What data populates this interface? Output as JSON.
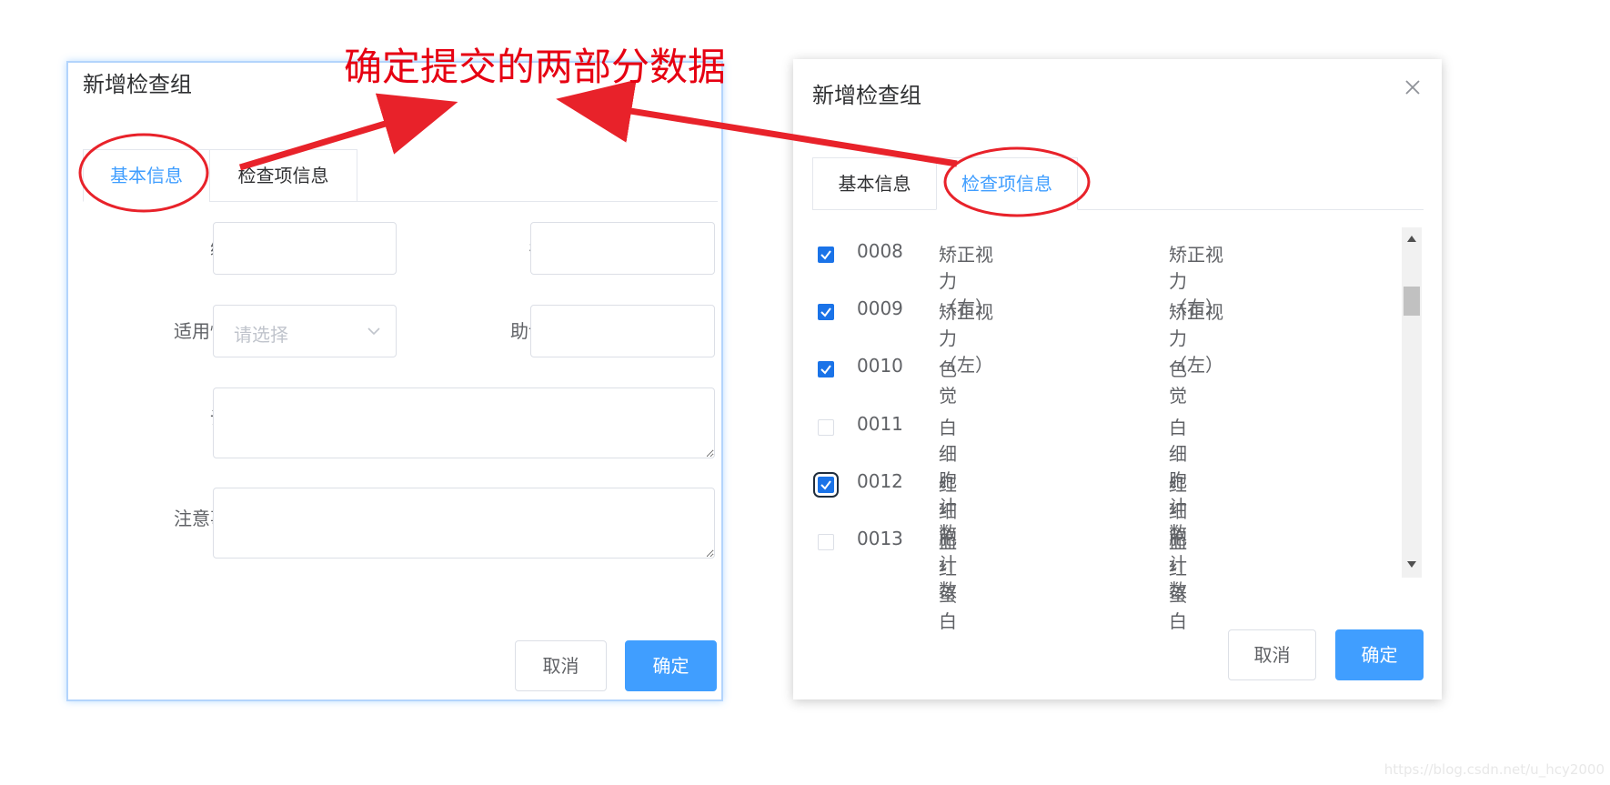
{
  "annotation": {
    "text": "确定提交的两部分数据",
    "color": "#e60012"
  },
  "left_dialog": {
    "title": "新增检查组",
    "tabs": [
      {
        "label": "基本信息",
        "active": true
      },
      {
        "label": "检查项信息",
        "active": false
      }
    ],
    "form": {
      "code_label": "编码",
      "code_value": "",
      "name_label": "名称",
      "name_value": "",
      "sex_label": "适用性别",
      "sex_placeholder": "请选择",
      "helpcode_label": "助记码",
      "helpcode_value": "",
      "remark_label": "说明",
      "attention_label": "注意事项"
    },
    "buttons": {
      "cancel": "取消",
      "confirm": "确定"
    }
  },
  "right_dialog": {
    "title": "新增检查组",
    "tabs": [
      {
        "label": "基本信息",
        "active": false
      },
      {
        "label": "检查项信息",
        "active": true
      }
    ],
    "items": [
      {
        "code": "0008",
        "name": "矫正视力（右）",
        "remark": "矫正视力（右）",
        "checked": true
      },
      {
        "code": "0009",
        "name": "矫正视力（左）",
        "remark": "矫正视力（左）",
        "checked": true
      },
      {
        "code": "0010",
        "name": "色觉",
        "remark": "色觉",
        "checked": true
      },
      {
        "code": "0011",
        "name": "白细胞计数",
        "remark": "白细胞计数",
        "checked": false
      },
      {
        "code": "0012",
        "name": "红细胞计数",
        "remark": "红细胞计数",
        "checked": true
      },
      {
        "code": "0013",
        "name": "血红蛋白",
        "remark": "血红蛋白",
        "checked": false
      }
    ],
    "buttons": {
      "cancel": "取消",
      "confirm": "确定"
    }
  },
  "colors": {
    "primary": "#409eff",
    "checkbox_checked": "#1a73e8",
    "annotation_red": "#e60012"
  },
  "watermark": "https://blog.csdn.net/u_hcy2000"
}
